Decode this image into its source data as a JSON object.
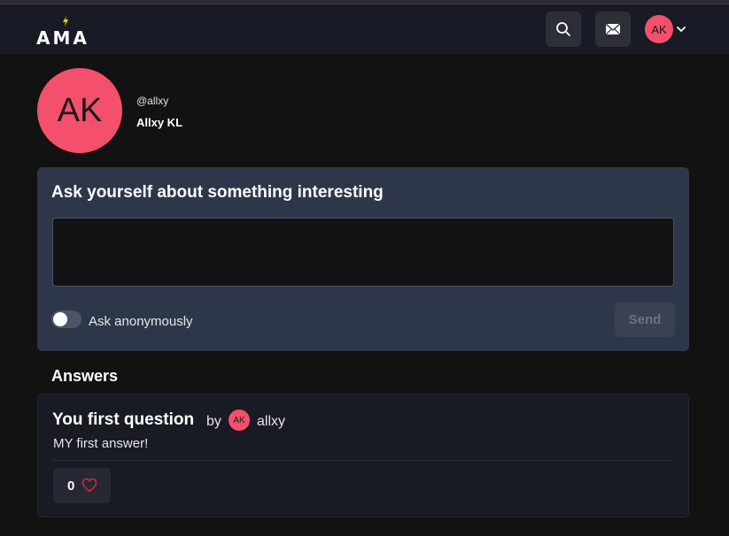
{
  "navbar": {
    "logo_text": "AMA",
    "avatar_initials": "AK",
    "icons": [
      "search-icon",
      "mail-icon",
      "chevron-down-icon",
      "bolt-icon"
    ]
  },
  "profile": {
    "avatar_initials": "AK",
    "handle": "@allxy",
    "name": "Allxy KL"
  },
  "ask": {
    "title": "Ask yourself about something interesting",
    "textarea_value": "",
    "anonymous_label": "Ask anonymously",
    "anonymous_on": false,
    "send_label": "Send"
  },
  "answers": {
    "heading": "Answers",
    "items": [
      {
        "question": "You first question",
        "by": "by",
        "avatar_initials": "AK",
        "user": "allxy",
        "answer": "MY first answer!",
        "likes": "0"
      }
    ]
  },
  "colors": {
    "accent": "#f4506b",
    "background": "#121212",
    "navbar": "#181b25",
    "card": "#2e3749"
  }
}
